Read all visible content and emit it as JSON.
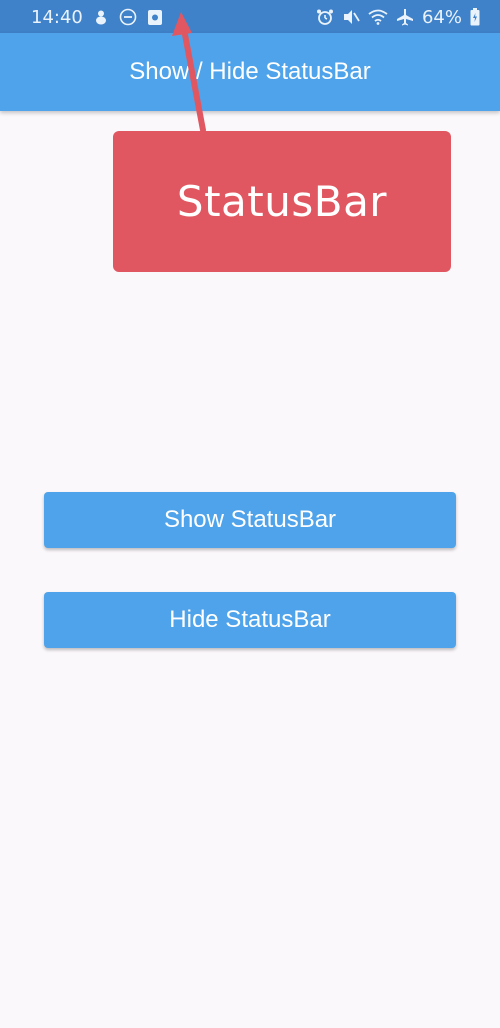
{
  "status_bar": {
    "time": "14:40",
    "battery": "64%",
    "left_icons": [
      "mascot-icon",
      "do-not-disturb-icon",
      "screenshot-icon"
    ],
    "right_icons": [
      "alarm-icon",
      "mute-icon",
      "wifi-icon",
      "airplane-icon",
      "battery-icon"
    ]
  },
  "app_bar": {
    "title": "Show / Hide StatusBar"
  },
  "callout": {
    "label": "StatusBar",
    "color": "#e15761"
  },
  "buttons": {
    "show_label": "Show StatusBar",
    "hide_label": "Hide StatusBar"
  },
  "colors": {
    "status_bar": "#3f82c9",
    "app_bar": "#4fa3ea",
    "button": "#4fa3ea",
    "background": "#fbf8fb"
  }
}
